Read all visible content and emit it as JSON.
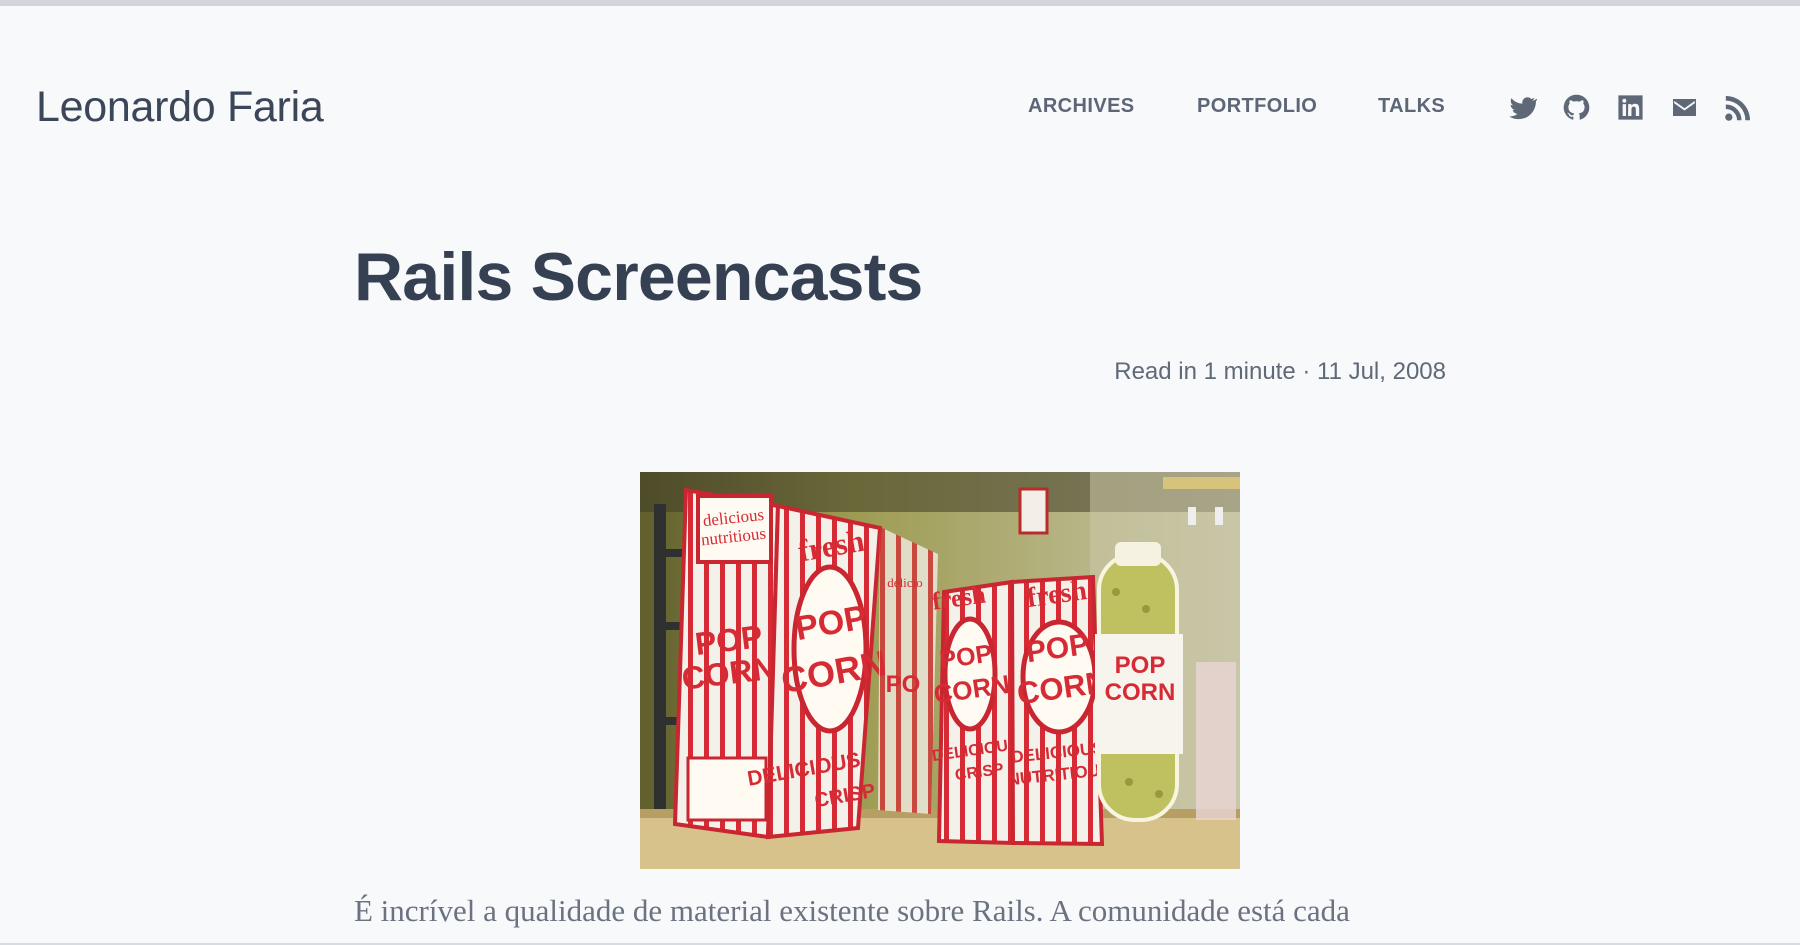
{
  "site": {
    "title": "Leonardo Faria"
  },
  "nav": {
    "archives": "ARCHIVES",
    "portfolio": "PORTFOLIO",
    "talks": "TALKS"
  },
  "social": [
    {
      "icon": "twitter-icon"
    },
    {
      "icon": "github-icon"
    },
    {
      "icon": "linkedin-icon"
    },
    {
      "icon": "email-icon"
    },
    {
      "icon": "rss-icon"
    }
  ],
  "post": {
    "title": "Rails Screencasts",
    "meta": "Read in 1 minute · 11 Jul, 2008",
    "body": "É incrível a qualidade de material existente sobre Rails. A comunidade está cada"
  },
  "image": {
    "box_left_text": "delicious\nnutritious",
    "box_left_brand": "POP CORN",
    "box_center_fresh": "fresh",
    "box_center_brand": "POP CORN",
    "box_center_bottom": "DELICIOUS CRISP",
    "box_right_fresh": "fresh",
    "box_right_brand": "POP CORN",
    "box_right_bottom": "DELICIOUS NUTRITIOUS",
    "jar_label": "POP CORN"
  },
  "colors": {
    "background": "#f8f9fb",
    "text": "#354152",
    "muted": "#606978",
    "accent": "#d81f2a"
  }
}
